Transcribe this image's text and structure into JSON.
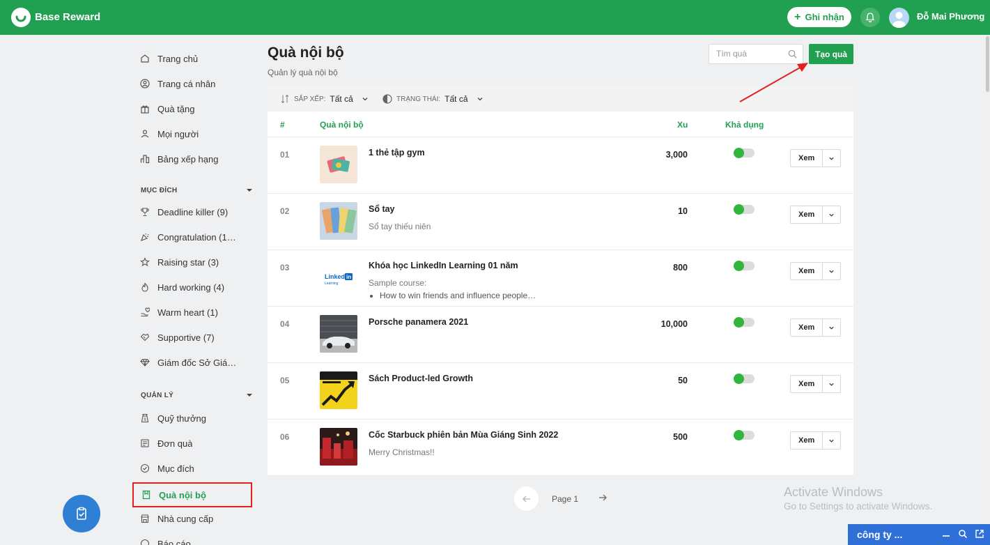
{
  "app": {
    "brand": "Base Reward"
  },
  "topbar": {
    "record_label": "Ghi nhận",
    "username": "Đỗ Mai Phương"
  },
  "sidebar": {
    "main": [
      {
        "label": "Trang chủ",
        "icon": "home-icon"
      },
      {
        "label": "Trang cá nhân",
        "icon": "user-circle-icon"
      },
      {
        "label": "Quà tặng",
        "icon": "gift-icon"
      },
      {
        "label": "Mọi người",
        "icon": "people-icon"
      },
      {
        "label": "Bảng xếp hạng",
        "icon": "leaderboard-icon"
      }
    ],
    "purpose_title": "MỤC ĐÍCH",
    "purpose": [
      {
        "label": "Deadline killer (9)",
        "icon": "trophy-icon"
      },
      {
        "label": "Congratulation (1…",
        "icon": "party-icon"
      },
      {
        "label": "Raising star (3)",
        "icon": "star-icon"
      },
      {
        "label": "Hard working (4)",
        "icon": "fire-icon"
      },
      {
        "label": "Warm heart (1)",
        "icon": "heart-hand-icon"
      },
      {
        "label": "Supportive (7)",
        "icon": "handshake-icon"
      },
      {
        "label": "Giám đốc Sở Giá…",
        "icon": "diamond-icon"
      }
    ],
    "manage_title": "QUẢN LÝ",
    "manage": [
      {
        "label": "Quỹ thưởng",
        "icon": "fund-icon"
      },
      {
        "label": "Đơn quà",
        "icon": "order-icon"
      },
      {
        "label": "Mục đích",
        "icon": "target-icon"
      },
      {
        "label": "Quà nội bộ",
        "icon": "bookmark-icon"
      },
      {
        "label": "Nhà cung cấp",
        "icon": "store-icon"
      },
      {
        "label": "Báo cáo",
        "icon": "report-icon"
      }
    ]
  },
  "main": {
    "title": "Quà nội bộ",
    "subtitle": "Quản lý quà nội bộ",
    "search_placeholder": "Tìm quà",
    "create_label": "Tạo quà",
    "filters": {
      "sort_key": "SẮP XẾP:",
      "sort_val": "Tất cả",
      "status_key": "TRẠNG THÁI:",
      "status_val": "Tất cả"
    },
    "columns": {
      "num": "#",
      "name": "Quà nội bộ",
      "xu": "Xu",
      "available": "Khả dụng"
    },
    "rows": [
      {
        "num": "01",
        "name": "1 thẻ tập gym",
        "desc": "",
        "xu": "3,000",
        "available": true
      },
      {
        "num": "02",
        "name": "Sổ tay",
        "desc": "Sổ tay thiếu niên",
        "xu": "10",
        "available": true
      },
      {
        "num": "03",
        "name": "Khóa học LinkedIn Learning 01 năm",
        "desc": "Sample course:",
        "bullet": "How to win friends and influence people…",
        "xu": "800",
        "available": true
      },
      {
        "num": "04",
        "name": "Porsche panamera 2021",
        "desc": "",
        "xu": "10,000",
        "available": true
      },
      {
        "num": "05",
        "name": "Sách Product-led Growth",
        "desc": "",
        "xu": "50",
        "available": true
      },
      {
        "num": "06",
        "name": "Cốc Starbuck phiên bản Mùa Giáng Sinh 2022",
        "desc": "Merry Christmas!!",
        "xu": "500",
        "available": true
      }
    ],
    "view_label": "Xem",
    "page_label": "Page 1"
  },
  "watermark": {
    "line1": "Activate Windows",
    "line2": "Go to Settings to activate Windows."
  },
  "chat": {
    "label": "công ty ..."
  },
  "colors": {
    "brand_green": "#22a052",
    "highlight_red": "#e02020",
    "chat_blue": "#2f6fd8"
  }
}
